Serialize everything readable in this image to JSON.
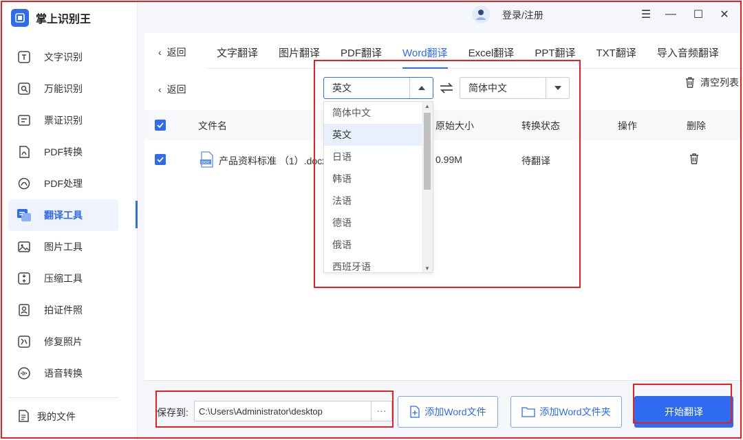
{
  "app": {
    "title": "掌上识别王"
  },
  "sidebar": {
    "items": [
      {
        "label": "文字识别"
      },
      {
        "label": "万能识别"
      },
      {
        "label": "票证识别"
      },
      {
        "label": "PDF转换"
      },
      {
        "label": "PDF处理"
      },
      {
        "label": "翻译工具",
        "active": true
      },
      {
        "label": "图片工具"
      },
      {
        "label": "压缩工具"
      },
      {
        "label": "拍证件照"
      },
      {
        "label": "修复照片"
      },
      {
        "label": "语音转换"
      }
    ],
    "my_files": "我的文件"
  },
  "topbar": {
    "login": "登录/注册",
    "menu_glyph": "☰",
    "minimize_glyph": "—",
    "maximize_glyph": "☐",
    "close_glyph": "✕"
  },
  "tabs": {
    "back": "返回",
    "items": [
      {
        "label": "文字翻译"
      },
      {
        "label": "图片翻译"
      },
      {
        "label": "PDF翻译"
      },
      {
        "label": "Word翻译",
        "active": true
      },
      {
        "label": "Excel翻译"
      },
      {
        "label": "PPT翻译"
      },
      {
        "label": "TXT翻译"
      },
      {
        "label": "导入音频翻译"
      }
    ]
  },
  "toolbar": {
    "back": "返回",
    "source_lang": "英文",
    "target_lang": "简体中文",
    "clear_list": "清空列表"
  },
  "dropdown": {
    "options": [
      "简体中文",
      "英文",
      "日语",
      "韩语",
      "法语",
      "德语",
      "俄语",
      "西班牙语"
    ],
    "selected_index": 1
  },
  "table": {
    "headers": {
      "filename": "文件名",
      "size": "原始大小",
      "status": "转换状态",
      "action": "操作",
      "delete": "删除"
    },
    "rows": [
      {
        "filename": "产品资料标准 （1）.docx",
        "size": "0.99M",
        "status": "待翻译"
      }
    ]
  },
  "bottom": {
    "save_label": "保存到:",
    "save_path": "C:\\Users\\Administrator\\desktop",
    "more": "···",
    "add_file": "添加Word文件",
    "add_folder": "添加Word文件夹",
    "start": "开始翻译"
  },
  "colors": {
    "accent": "#2f6bf0",
    "annotation": "#e62020"
  }
}
